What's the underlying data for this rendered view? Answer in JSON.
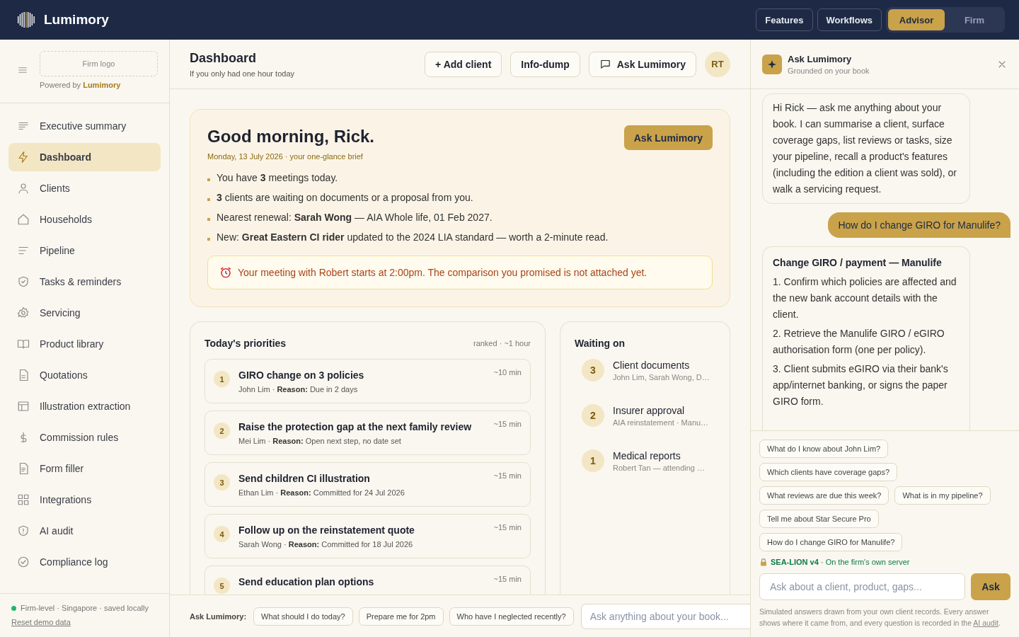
{
  "brand": {
    "name": "Lumimory"
  },
  "top_nav": {
    "links": [
      {
        "label": "Features"
      },
      {
        "label": "Workflows"
      }
    ],
    "mode_switch": [
      {
        "label": "Advisor",
        "selected": true
      },
      {
        "label": "Firm",
        "selected": false
      }
    ]
  },
  "sidebar": {
    "firm_logo": "Firm logo",
    "powered_by": "Powered by **Lumimory**",
    "items": [
      {
        "label": "Executive summary",
        "selected": false
      },
      {
        "label": "Dashboard",
        "selected": true
      },
      {
        "label": "Clients",
        "selected": false
      },
      {
        "label": "Households",
        "selected": false
      },
      {
        "label": "Pipeline",
        "selected": false
      },
      {
        "label": "Tasks & reminders",
        "selected": false
      },
      {
        "label": "Servicing",
        "selected": false
      },
      {
        "label": "Product library",
        "selected": false
      },
      {
        "label": "Quotations",
        "selected": false
      },
      {
        "label": "Illustration extraction",
        "selected": false
      },
      {
        "label": "Commission rules",
        "selected": false
      },
      {
        "label": "Form filler",
        "selected": false
      },
      {
        "label": "Integrations",
        "selected": false
      },
      {
        "label": "AI audit",
        "selected": false
      },
      {
        "label": "Compliance log",
        "selected": false
      }
    ],
    "footer": {
      "status": "Firm-level · Singapore · saved locally",
      "reset_link": "Reset demo data"
    }
  },
  "header": {
    "title": "Dashboard",
    "subtitle": "If you only had one hour today",
    "buttons": [
      {
        "label": "+ Add client",
        "kind": "plain"
      },
      {
        "label": "Info-dump",
        "kind": "plain"
      },
      {
        "label": "Ask Lumimory",
        "kind": "chat"
      }
    ],
    "avatar": "RT"
  },
  "brief": {
    "greeting": "Good morning, Rick.",
    "date": "Monday, 13 July 2026 · your one-glance brief",
    "button": "Ask Lumimory",
    "bullets": [
      "You have **3** meetings today.",
      "**3** clients are waiting on documents or a proposal from you.",
      "Nearest renewal: **Sarah Wong** — AIA Whole life, 01 Feb 2027.",
      "New: **Great Eastern CI rider** updated to the 2024 LIA standard — worth a 2-minute read."
    ],
    "alert": "Your meeting with Robert starts at 2:00pm. The comparison you promised is not attached yet."
  },
  "priorities": {
    "title": "Today's priorities",
    "meta": "ranked · ~1 hour",
    "items": [
      {
        "rank": "1",
        "title": "GIRO change on 3 policies",
        "detail": "John Lim · **Reason:** Due in 2 days",
        "duration": "~10 min"
      },
      {
        "rank": "2",
        "title": "Raise the protection gap at the next family review",
        "detail": "Mei Lim · **Reason:** Open next step, no date set",
        "duration": "~15 min"
      },
      {
        "rank": "3",
        "title": "Send children CI illustration",
        "detail": "Ethan Lim · **Reason:** Committed for 24 Jul 2026",
        "duration": "~15 min"
      },
      {
        "rank": "4",
        "title": "Follow up on the reinstatement quote",
        "detail": "Sarah Wong · **Reason:** Committed for 18 Jul 2026",
        "duration": "~15 min"
      },
      {
        "rank": "5",
        "title": "Send education plan options",
        "duration": "~15 min"
      }
    ]
  },
  "waiting_on": {
    "title": "Waiting on",
    "items": [
      {
        "count": "3",
        "title": "Client documents",
        "detail": "John Lim, Sarah Wong, D…"
      },
      {
        "count": "2",
        "title": "Insurer approval",
        "detail": "AIA reinstatement · Manu…"
      },
      {
        "count": "1",
        "title": "Medical reports",
        "detail": "Robert Tan — attending …"
      }
    ]
  },
  "quick_ask": {
    "label": "Ask Lumimory:",
    "chips": [
      "What should I do today?",
      "Prepare me for 2pm",
      "Who have I neglected recently?"
    ],
    "placeholder": "Ask anything about your book..."
  },
  "chat": {
    "title": "Ask Lumimory",
    "subtitle": "Grounded on your book",
    "messages": [
      {
        "kind": "assistant",
        "text": "Hi Rick — ask me anything about your book. I can summarise a client, surface coverage gaps, list reviews or tasks, size your pipeline, recall a product's features (including the edition a client was sold), or walk a servicing request."
      },
      {
        "kind": "user",
        "text": "How do I change GIRO for Manulife?"
      },
      {
        "kind": "assistant",
        "heading": "Change GIRO / payment — Manulife",
        "steps": [
          "1. Confirm which policies are affected and the new bank account details with the client.",
          "2. Retrieve the Manulife GIRO / eGIRO authorisation form (one per policy).",
          "3. Client submits eGIRO via their bank's app/internet banking, or signs the paper GIRO form."
        ]
      }
    ],
    "suggestions": [
      "What do I know about John Lim?",
      "Which clients have coverage gaps?",
      "What reviews are due this week?",
      "What is in my pipeline?",
      "Tell me about Star Secure Pro",
      "How do I change GIRO for Manulife?"
    ],
    "model": {
      "name": "SEA-LION v4",
      "note": "· On the firm's own server"
    },
    "input_placeholder": "Ask about a client, product, gaps...",
    "send": "Ask",
    "disclaimer": {
      "text": "Simulated answers drawn from your own client records. Every answer shows where it came from, and every question is recorded in the ",
      "link": "AI audit",
      "end": "."
    }
  }
}
